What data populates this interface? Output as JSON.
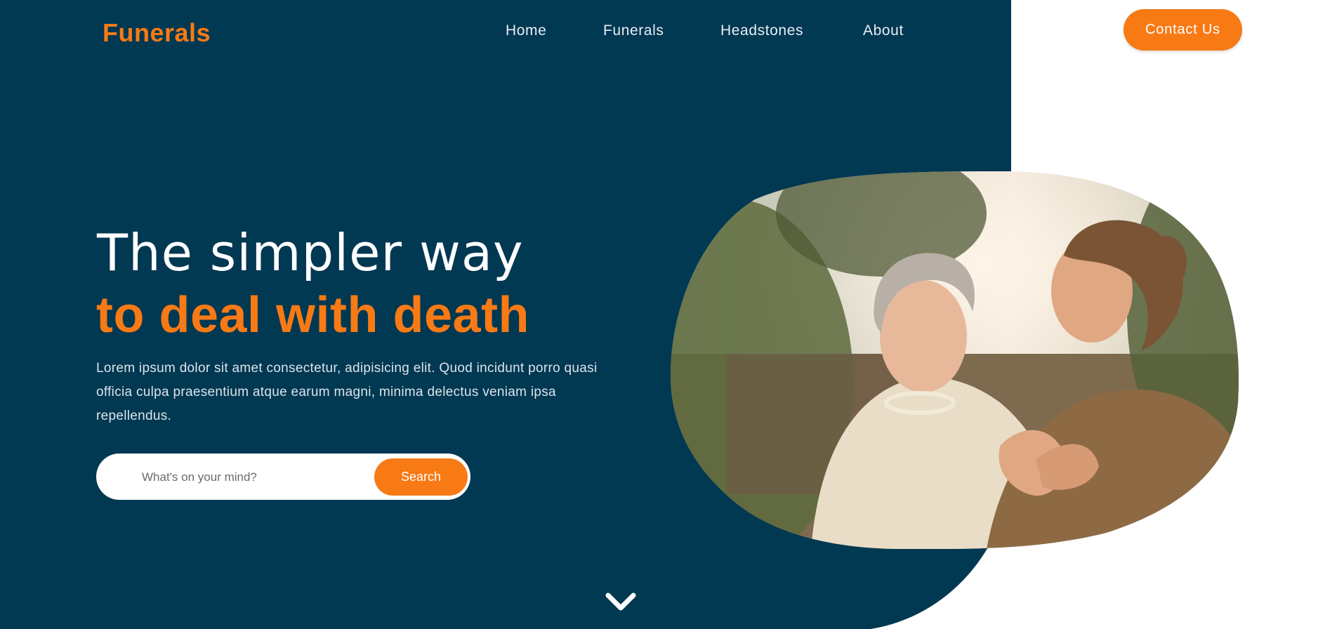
{
  "brand": {
    "logo": "Funerals"
  },
  "nav": {
    "items": [
      {
        "label": "Home"
      },
      {
        "label": "Funerals"
      },
      {
        "label": "Headstones"
      },
      {
        "label": "About"
      }
    ],
    "contact_label": "Contact Us"
  },
  "hero": {
    "title_line1": "The simpler way",
    "title_line2": "to deal with death",
    "description": "Lorem ipsum dolor sit amet consectetur, adipisicing elit. Quod incidunt porro quasi officia culpa praesentium atque earum magni, minima delectus veniam ipsa repellendus.",
    "search": {
      "placeholder": "What's on your mind?",
      "button_label": "Search"
    }
  },
  "colors": {
    "panel": "#013852",
    "accent": "#f77a15",
    "background": "#ffffff"
  },
  "icons": {
    "scroll": "chevron-down-icon"
  }
}
